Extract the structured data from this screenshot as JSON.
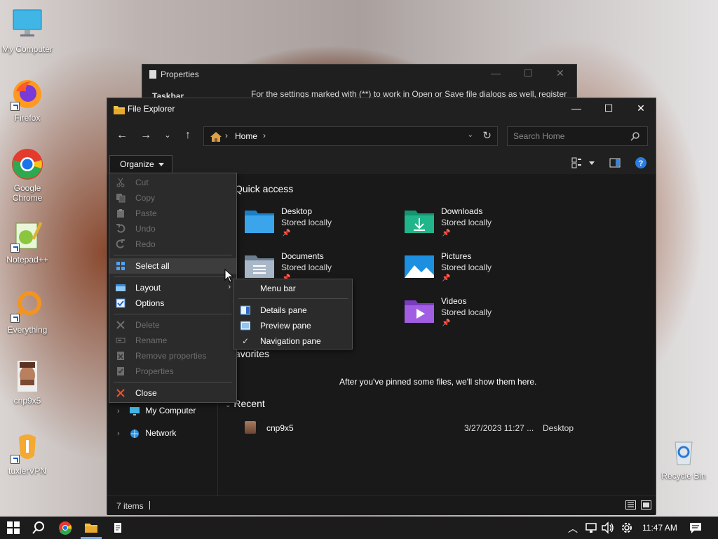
{
  "desktop": {
    "icons": [
      {
        "label": "My Computer"
      },
      {
        "label": "Firefox"
      },
      {
        "label": "Google Chrome"
      },
      {
        "label": "Notepad++"
      },
      {
        "label": "Everything"
      },
      {
        "label": "cnp9x5"
      },
      {
        "label": "tuxlerVPN"
      },
      {
        "label": "Recycle Bin"
      }
    ]
  },
  "properties_window": {
    "title": "Properties",
    "tab": "Taskbar",
    "note": "For the settings marked with (**) to work in Open or Save file dialogs as well, register"
  },
  "explorer": {
    "title": "File Explorer",
    "address": {
      "crumb": "Home"
    },
    "search": {
      "placeholder": "Search Home"
    },
    "organize_label": "Organize",
    "nav_tree": [
      {
        "label": "My Computer"
      },
      {
        "label": "Network"
      }
    ],
    "quick_access": {
      "heading": "Quick access",
      "items": [
        {
          "name": "Desktop",
          "sub": "Stored locally"
        },
        {
          "name": "Downloads",
          "sub": "Stored locally"
        },
        {
          "name": "Documents",
          "sub": "Stored locally"
        },
        {
          "name": "Pictures",
          "sub": "Stored locally"
        },
        {
          "name": "Videos",
          "sub": "Stored locally"
        }
      ]
    },
    "favorites": {
      "heading": "avorites",
      "empty_message": "After you've pinned some files, we'll show them here."
    },
    "recent": {
      "heading": "Recent",
      "rows": [
        {
          "name": "cnp9x5",
          "date": "3/27/2023 11:27 ...",
          "location": "Desktop"
        }
      ]
    },
    "status": {
      "count": "7 items"
    }
  },
  "organize_menu": {
    "items": [
      {
        "label": "Cut"
      },
      {
        "label": "Copy"
      },
      {
        "label": "Paste"
      },
      {
        "label": "Undo"
      },
      {
        "label": "Redo"
      },
      {
        "label": "Select all"
      },
      {
        "label": "Layout"
      },
      {
        "label": "Options"
      },
      {
        "label": "Delete"
      },
      {
        "label": "Rename"
      },
      {
        "label": "Remove properties"
      },
      {
        "label": "Properties"
      },
      {
        "label": "Close"
      }
    ]
  },
  "layout_submenu": {
    "items": [
      {
        "label": "Menu bar"
      },
      {
        "label": "Details pane"
      },
      {
        "label": "Preview pane"
      },
      {
        "label": "Navigation pane"
      }
    ]
  },
  "taskbar": {
    "clock": "11:47 AM"
  }
}
